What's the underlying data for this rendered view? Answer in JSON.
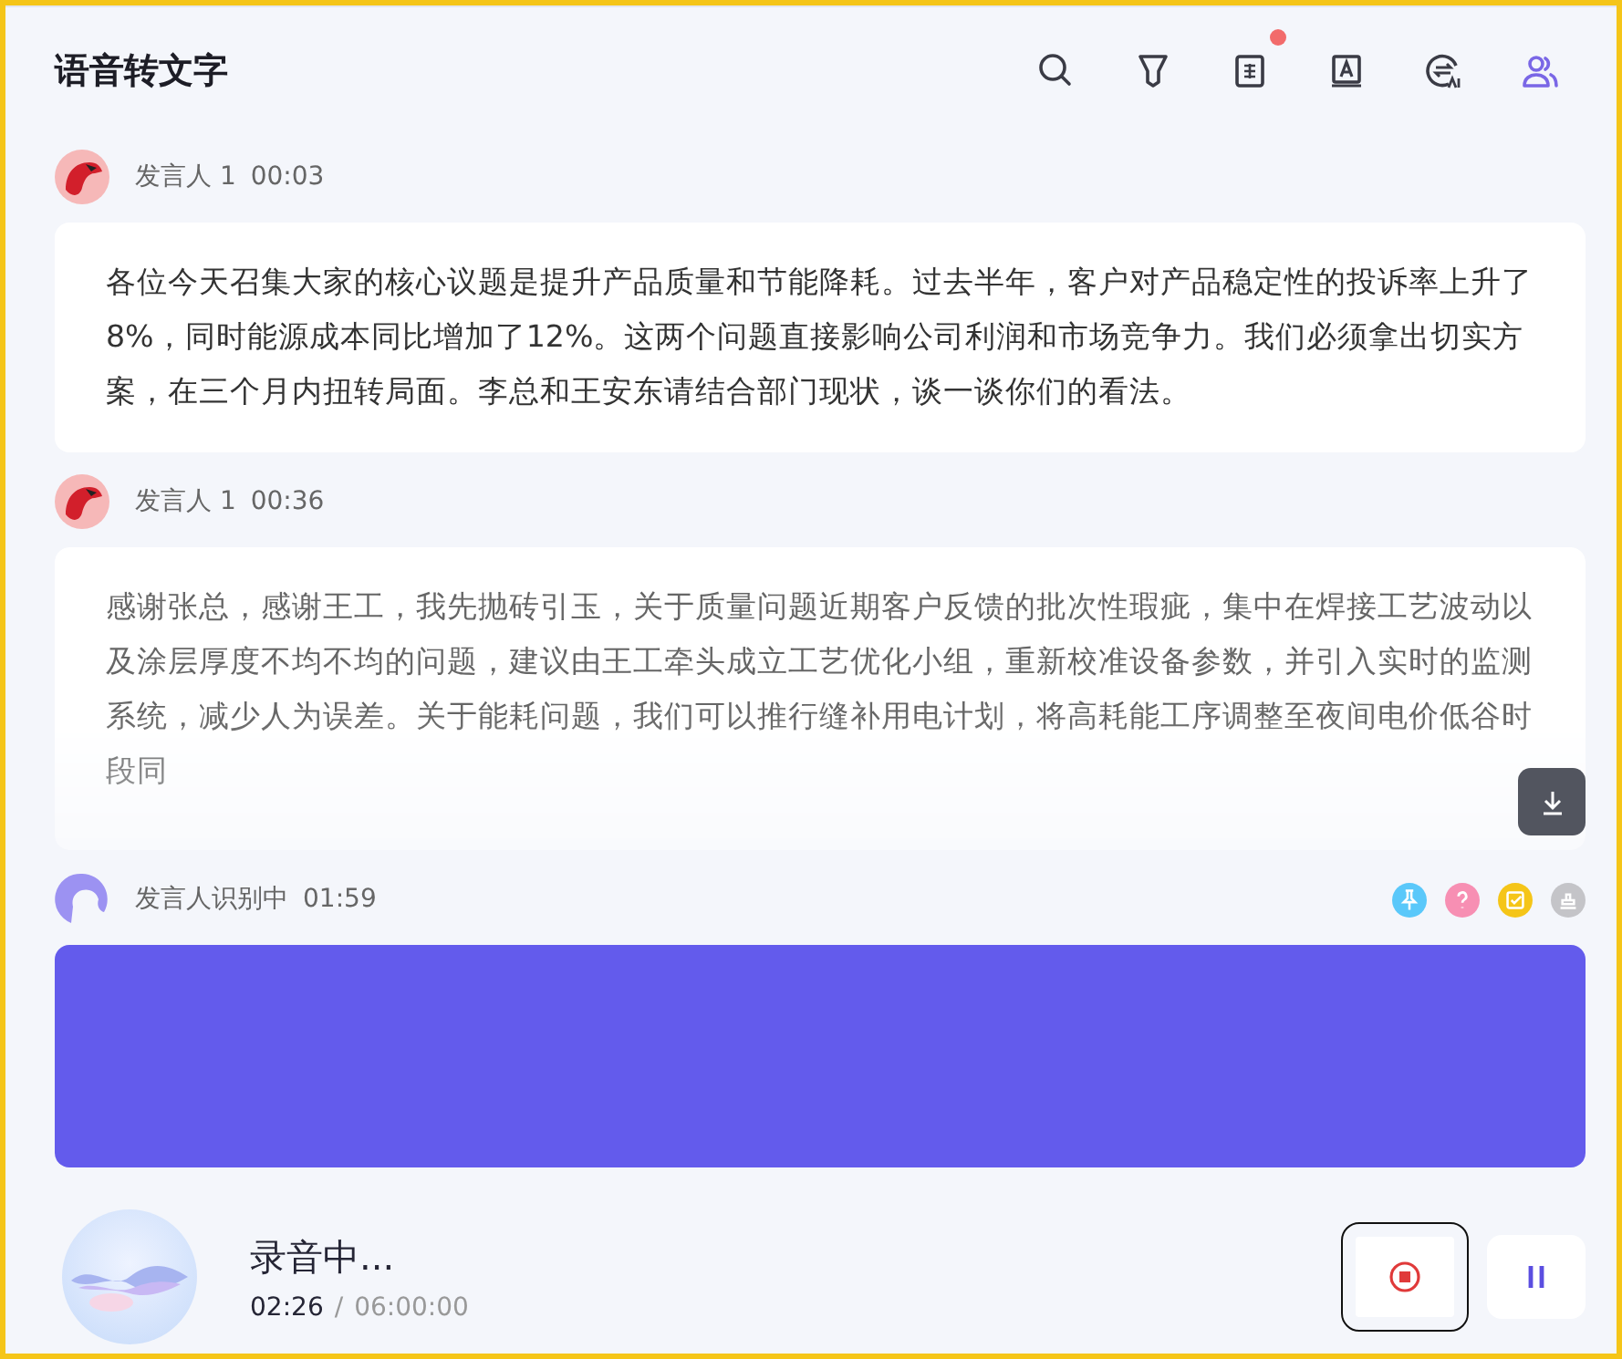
{
  "header": {
    "title": "语音转文字",
    "icons": [
      {
        "kind": "search",
        "badge": false,
        "selected": false
      },
      {
        "kind": "filter",
        "badge": false,
        "selected": false
      },
      {
        "kind": "translate",
        "badge": true,
        "selected": false
      },
      {
        "kind": "text",
        "badge": false,
        "selected": false
      },
      {
        "kind": "ai",
        "badge": false,
        "selected": false
      },
      {
        "kind": "speakers",
        "badge": false,
        "selected": true
      }
    ]
  },
  "messages": [
    {
      "kind": "done",
      "speaker": "发言人 1",
      "time": "00:03",
      "text": "各位今天召集大家的核心议题是提升产品质量和节能降耗。过去半年，客户对产品稳定性的投诉率上升了8%，同时能源成本同比增加了12%。这两个问题直接影响公司利润和市场竞争力。我们必须拿出切实方案，在三个月内扭转局面。李总和王安东请结合部门现状，谈一谈你们的看法。"
    },
    {
      "kind": "partial",
      "speaker": "发言人 1",
      "time": "00:36",
      "text": "感谢张总，感谢王工，我先抛砖引玉，关于质量问题近期客户反馈的批次性瑕疵，集中在焊接工艺波动以及涂层厚度不均不均的问题，建议由王工牵头成立工艺优化小组，重新校准设备参数，并引入实时的监测系统，减少人为误差。关于能耗问题，我们可以推行缝补用电计划，将高耗能工序调整至夜间电价低谷时段同"
    },
    {
      "kind": "live",
      "speaker": "发言人识别中",
      "time": "01:59",
      "tags": [
        {
          "kind": "pin",
          "color": "#5ac8fa"
        },
        {
          "kind": "question",
          "color": "#f78fb3"
        },
        {
          "kind": "todo",
          "color": "#f5c518"
        },
        {
          "kind": "stamp",
          "color": "#c4c4c8"
        }
      ]
    }
  ],
  "recorder": {
    "status": "录音中...",
    "elapsed": "02:26",
    "separator": "/",
    "total": "06:00:00",
    "stop_focused": true
  }
}
